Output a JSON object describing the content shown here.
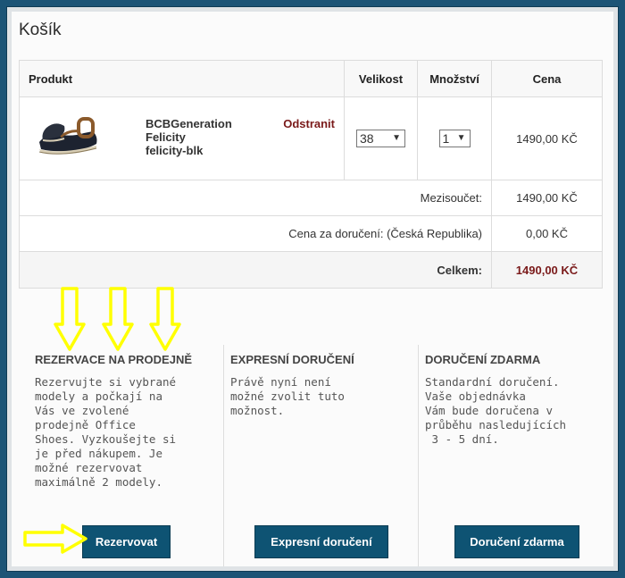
{
  "cart": {
    "title": "Košík",
    "headers": {
      "product": "Produkt",
      "size": "Velikost",
      "quantity": "Množství",
      "price": "Cena"
    },
    "item": {
      "brand": "BCBGeneration",
      "model": "Felicity",
      "sku": "felicity-blk",
      "remove_label": "Odstranit",
      "size": "38",
      "quantity": "1",
      "price": "1490,00 KČ"
    },
    "subtotal": {
      "label": "Mezisoučet:",
      "value": "1490,00 KČ"
    },
    "shipping": {
      "label": "Cena za doručení: (Česká Republika)",
      "value": "0,00 KČ"
    },
    "total": {
      "label": "Celkem:",
      "value": "1490,00 KČ"
    }
  },
  "delivery": {
    "reserve": {
      "heading": "REZERVACE NA PRODEJNĚ",
      "text": "Rezervujte si vybrané\nmodely a počkají na\nVás ve zvolené\nprodejně Office\nShoes. Vyzkoušejte si\nje před nákupem. Je\nmožné rezervovat\nmaximálně 2 modely.",
      "button": "Rezervovat"
    },
    "express": {
      "heading": "EXPRESNÍ DORUČENÍ",
      "text": "Právě nyní není\nmožné zvolit tuto\nmožnost.",
      "button": "Expresní doručení"
    },
    "free": {
      "heading": "DORUČENÍ ZDARMA",
      "text": "Standardní doručení.\nVaše objednávka\nVám bude doručena v\nprůběhu nasledujících\n 3 - 5 dní.",
      "button": "Doručení zdarma"
    }
  },
  "colors": {
    "frame": "#1c5476",
    "button": "#0e5373",
    "accent_red": "#7a1a1a",
    "annotation_yellow": "#ffff00"
  },
  "icons": [
    "shoe-image",
    "select-arrow-icon",
    "annotation-arrow-down-icon",
    "annotation-arrow-right-icon"
  ]
}
